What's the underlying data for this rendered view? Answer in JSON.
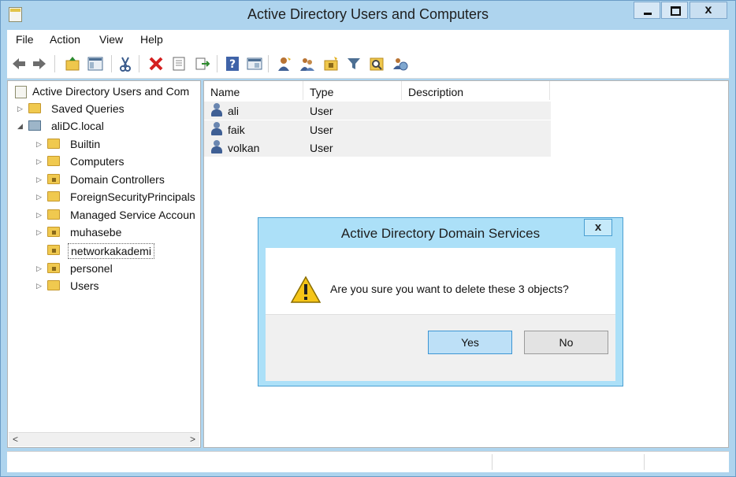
{
  "window": {
    "title": "Active Directory Users and Computers",
    "close_glyph": "x"
  },
  "menubar": {
    "items": [
      "File",
      "Action",
      "View",
      "Help"
    ]
  },
  "toolbar": {
    "icons": [
      "back-arrow-icon",
      "forward-arrow-icon",
      "up-folder-icon",
      "show-hide-tree-icon",
      "cut-icon",
      "delete-icon",
      "properties-icon",
      "export-list-icon",
      "help-icon",
      "console-icon",
      "new-user-icon",
      "new-group-icon",
      "new-ou-icon",
      "filter-icon",
      "find-icon",
      "add-to-group-icon"
    ]
  },
  "tree": {
    "root": "Active Directory Users and Com",
    "saved_queries": "Saved Queries",
    "domain": "aliDC.local",
    "children": [
      "Builtin",
      "Computers",
      "Domain Controllers",
      "ForeignSecurityPrincipals",
      "Managed Service Accoun",
      "muhasebe",
      "networkakademi",
      "personel",
      "Users"
    ],
    "selected": "networkakademi"
  },
  "list": {
    "columns": [
      "Name",
      "Type",
      "Description"
    ],
    "rows": [
      {
        "name": "ali",
        "type": "User"
      },
      {
        "name": "faik",
        "type": "User"
      },
      {
        "name": "volkan",
        "type": "User"
      }
    ]
  },
  "dialog": {
    "title": "Active Directory Domain Services",
    "close_glyph": "x",
    "message": "Are you sure you want to delete these 3 objects?",
    "yes": "Yes",
    "no": "No"
  },
  "scroll": {
    "left": "<",
    "right": ">"
  },
  "colors": {
    "accent": "#3c95d4",
    "frame": "#aed4ee",
    "dialog_frame": "#ace0f8"
  }
}
